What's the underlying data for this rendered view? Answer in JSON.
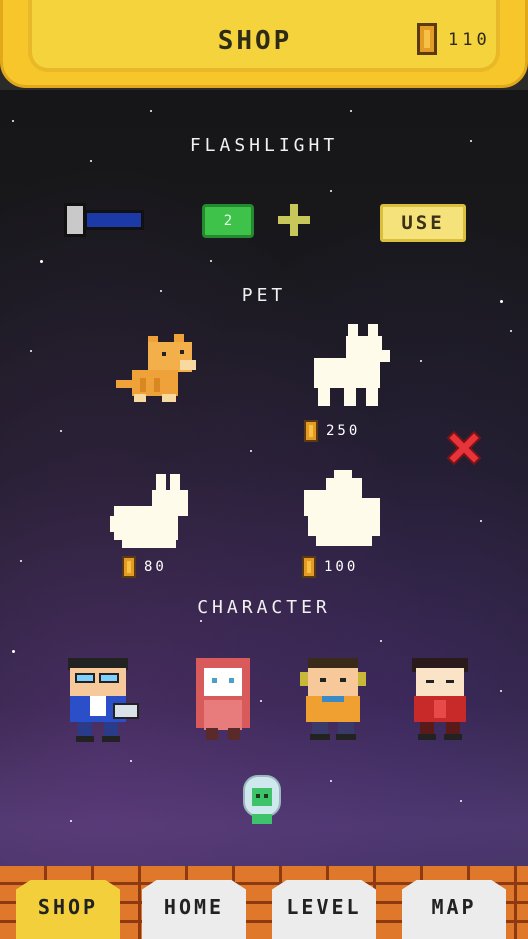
{
  "header": {
    "title": "SHOP",
    "coins": "110"
  },
  "flashlight": {
    "title": "FLASHLIGHT",
    "count": "2",
    "use_label": "USE"
  },
  "pet": {
    "title": "PET",
    "items": [
      {
        "name": "cat",
        "owned": true
      },
      {
        "name": "dog",
        "owned": false,
        "price": "250"
      },
      {
        "name": "rabbit",
        "owned": false,
        "price": "80"
      },
      {
        "name": "chicken",
        "owned": false,
        "price": "100"
      }
    ]
  },
  "character": {
    "title": "CHARACTER",
    "items": [
      "boy-with-glasses",
      "girl-in-hijab",
      "boy-with-headphones",
      "boy-in-red"
    ]
  },
  "nav": {
    "shop": "SHOP",
    "home": "HOME",
    "level": "LEVEL",
    "map": "MAP",
    "active": "shop"
  },
  "colors": {
    "header_yellow": "#f5d33d",
    "use_button": "#f6e27a",
    "count_badge": "#3ec24a",
    "brick": "#e0782c",
    "close_red": "#e8333a"
  }
}
